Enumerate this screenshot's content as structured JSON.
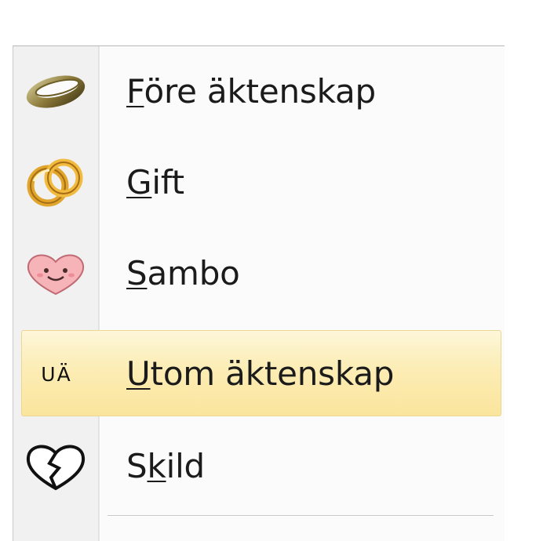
{
  "menu": {
    "items": [
      {
        "pre": "",
        "accel": "F",
        "post": "öre äktenskap",
        "icon": "ring-icon",
        "highlighted": false
      },
      {
        "pre": "",
        "accel": "G",
        "post": "ift",
        "icon": "wedding-rings-icon",
        "highlighted": false
      },
      {
        "pre": "",
        "accel": "S",
        "post": "ambo",
        "icon": "smiling-heart-icon",
        "highlighted": false
      },
      {
        "pre": "",
        "accel": "U",
        "post": "tom äktenskap",
        "icon": "ua-text-icon",
        "icon_text": "UÄ",
        "highlighted": true
      },
      {
        "pre": "S",
        "accel": "k",
        "post": "ild",
        "icon": "broken-heart-icon",
        "highlighted": false
      }
    ]
  },
  "colors": {
    "highlight_top": "#fdf6d9",
    "highlight_bottom": "#fbe59d",
    "highlight_border": "#ecd790",
    "gutter": "#f1f1f1",
    "menu_background": "#fbfbfb"
  }
}
